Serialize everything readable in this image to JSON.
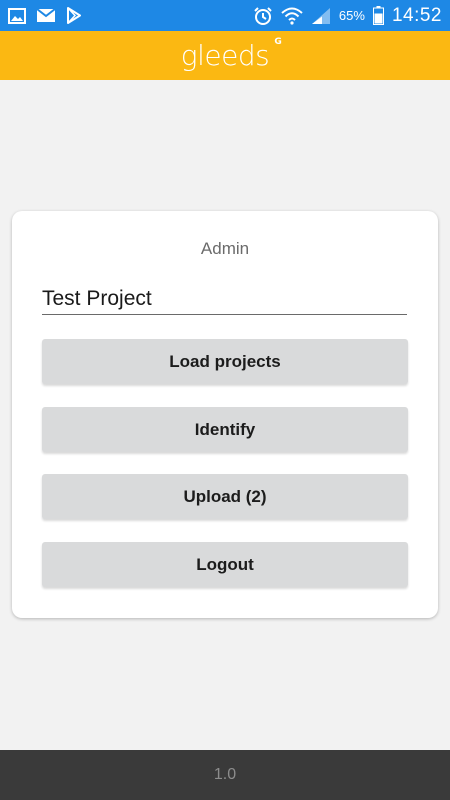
{
  "status_bar": {
    "icons_left": [
      "gallery-icon",
      "mail-icon",
      "play-store-icon"
    ],
    "icons_right": [
      "alarm-icon",
      "wifi-icon",
      "signal-icon",
      "battery-icon"
    ],
    "battery_percent": "65%",
    "time": "14:52",
    "color": "#1e88e5"
  },
  "app_bar": {
    "logo_text": "gleeds",
    "logo_mark": "G",
    "color": "#fbb812"
  },
  "card": {
    "title": "Admin",
    "project_input_value": "Test Project",
    "buttons": {
      "load_projects": "Load projects",
      "identify": "Identify",
      "upload": "Upload (2)",
      "logout": "Logout"
    }
  },
  "footer": {
    "version": "1.0"
  }
}
